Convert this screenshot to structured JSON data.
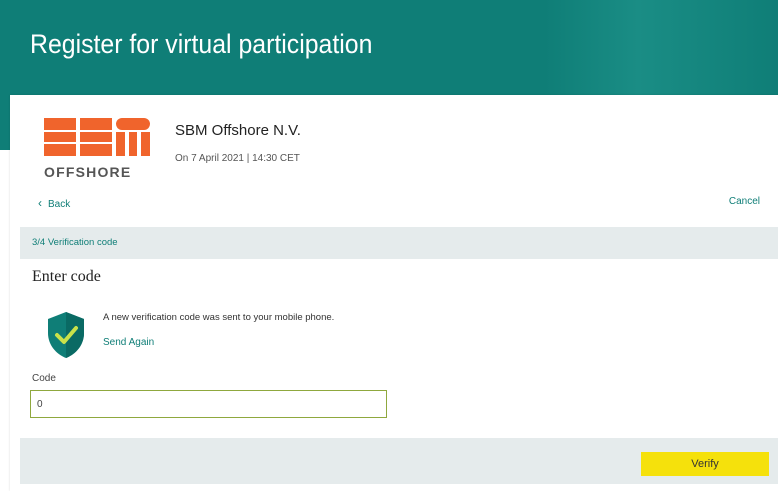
{
  "header": {
    "title": "Register for virtual participation"
  },
  "company": {
    "logo_text": "SBM OFFSHORE",
    "name": "SBM Offshore N.V.",
    "date": "On 7 April 2021 | 14:30 CET"
  },
  "nav": {
    "back_label": "Back",
    "cancel_label": "Cancel"
  },
  "step": {
    "label": "3/4 Verification code"
  },
  "form": {
    "title": "Enter code",
    "message": "A new verification code was sent to your mobile phone.",
    "send_again_label": "Send Again",
    "code_label": "Code",
    "code_value": "0"
  },
  "actions": {
    "verify_label": "Verify"
  },
  "colors": {
    "brand_teal": "#0f7e77",
    "logo_orange": "#f0642c",
    "verify_yellow": "#f5e10c",
    "step_bar_bg": "#e5ebec"
  }
}
